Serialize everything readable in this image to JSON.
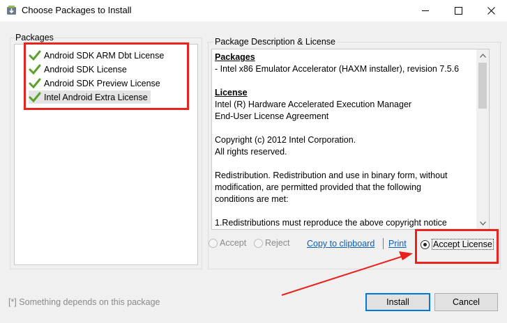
{
  "window": {
    "title": "Choose Packages to Install",
    "icon": "android-sdk-download-icon",
    "controls": {
      "minimize": "minimize-icon",
      "maximize": "maximize-icon",
      "close": "close-icon"
    }
  },
  "packages_panel": {
    "legend": "Packages",
    "items": [
      {
        "label": "Android SDK ARM Dbt License",
        "accepted": true,
        "selected": false
      },
      {
        "label": "Android SDK License",
        "accepted": true,
        "selected": false
      },
      {
        "label": "Android SDK Preview License",
        "accepted": true,
        "selected": false
      },
      {
        "label": "Intel Android Extra License",
        "accepted": true,
        "selected": true
      }
    ]
  },
  "description_panel": {
    "legend": "Package Description & License",
    "lines": [
      {
        "text": "Packages",
        "style": "heading"
      },
      {
        "text": "- Intel x86 Emulator Accelerator (HAXM installer), revision 7.5.6",
        "style": "normal"
      },
      {
        "text": "",
        "style": "blank"
      },
      {
        "text": "License",
        "style": "heading"
      },
      {
        "text": "Intel (R) Hardware Accelerated Execution Manager",
        "style": "normal"
      },
      {
        "text": "End-User License Agreement",
        "style": "normal"
      },
      {
        "text": "",
        "style": "blank"
      },
      {
        "text": "Copyright (c) 2012 Intel Corporation.",
        "style": "normal"
      },
      {
        "text": "All rights reserved.",
        "style": "normal"
      },
      {
        "text": "",
        "style": "blank"
      },
      {
        "text": "Redistribution. Redistribution and use in binary form, without",
        "style": "normal"
      },
      {
        "text": "modification, are permitted provided that the following",
        "style": "normal"
      },
      {
        "text": "conditions are met:",
        "style": "normal"
      },
      {
        "text": "",
        "style": "blank"
      },
      {
        "text": "1.Redistributions must reproduce the above copyright notice",
        "style": "normal"
      }
    ]
  },
  "license_actions": {
    "accept_label": "Accept",
    "reject_label": "Reject",
    "copy_link": "Copy to clipboard",
    "print_link": "Print",
    "accept_license_label": "Accept License",
    "accept_license_checked": true
  },
  "footer": {
    "note": "[*] Something depends on this package",
    "install_label": "Install",
    "cancel_label": "Cancel"
  },
  "colors": {
    "accent": "#0078d7",
    "check_green": "#5aa02c",
    "annotation_red": "#e8221c",
    "link": "#0a5fb4"
  }
}
